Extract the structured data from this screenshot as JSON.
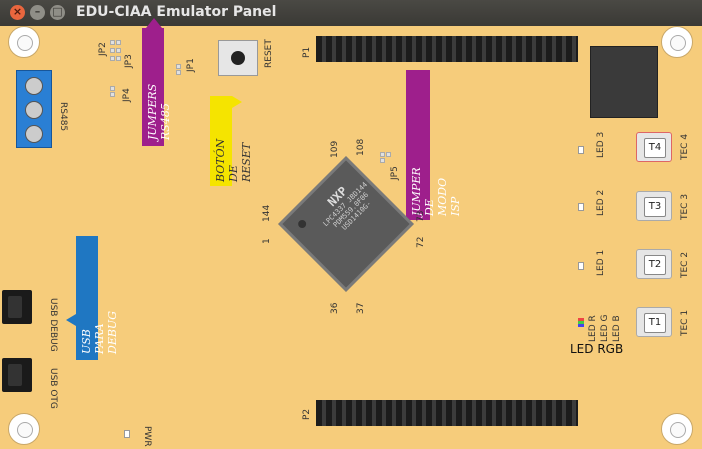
{
  "window": {
    "title": "EDU-CIAA Emulator Panel"
  },
  "connectors": {
    "p1": "P1",
    "p2": "P2"
  },
  "chip": {
    "brand": "NXP",
    "line1": "LPC4337 JBD144",
    "line2": "PDM559.0F06",
    "line3": "USD1410G-"
  },
  "pin_numbers": {
    "n109": "109",
    "n108": "108",
    "n144": "144",
    "n1": "1",
    "n73": "73",
    "n72": "72",
    "n36": "36",
    "n37": "37"
  },
  "labels": {
    "jp1": "JP1",
    "jp2": "JP2",
    "jp3": "JP3",
    "jp4": "JP4",
    "jp5": "JP5",
    "rs485": "RS485",
    "reset": "RESET",
    "pwr": "PWR",
    "usb_debug": "USB DEBUG",
    "usb_otg": "USB OTG",
    "led3": "LED 3",
    "led2": "LED 2",
    "led1": "LED 1",
    "led_r": "LED R",
    "led_g": "LED G",
    "led_b": "LED B",
    "led_rgb": "LED RGB"
  },
  "flags": {
    "jumpers_rs485": "JUMPERS RS485",
    "reset_button": "BOTÓN DE RESET",
    "jumper_modo_isp": "JUMPER DE MODO ISP",
    "usb_debug": "USB PARA DEBUG"
  },
  "buttons": [
    {
      "cap": "T4",
      "label": "TEC 4"
    },
    {
      "cap": "T3",
      "label": "TEC 3"
    },
    {
      "cap": "T2",
      "label": "TEC 2"
    },
    {
      "cap": "T1",
      "label": "TEC 1"
    }
  ],
  "colors": {
    "board": "#f6cc7b",
    "flag_purple": "#9e1f8c",
    "flag_yellow": "#f5e400",
    "flag_blue": "#1f77c2",
    "terminal_blue": "#2a7fd4"
  }
}
